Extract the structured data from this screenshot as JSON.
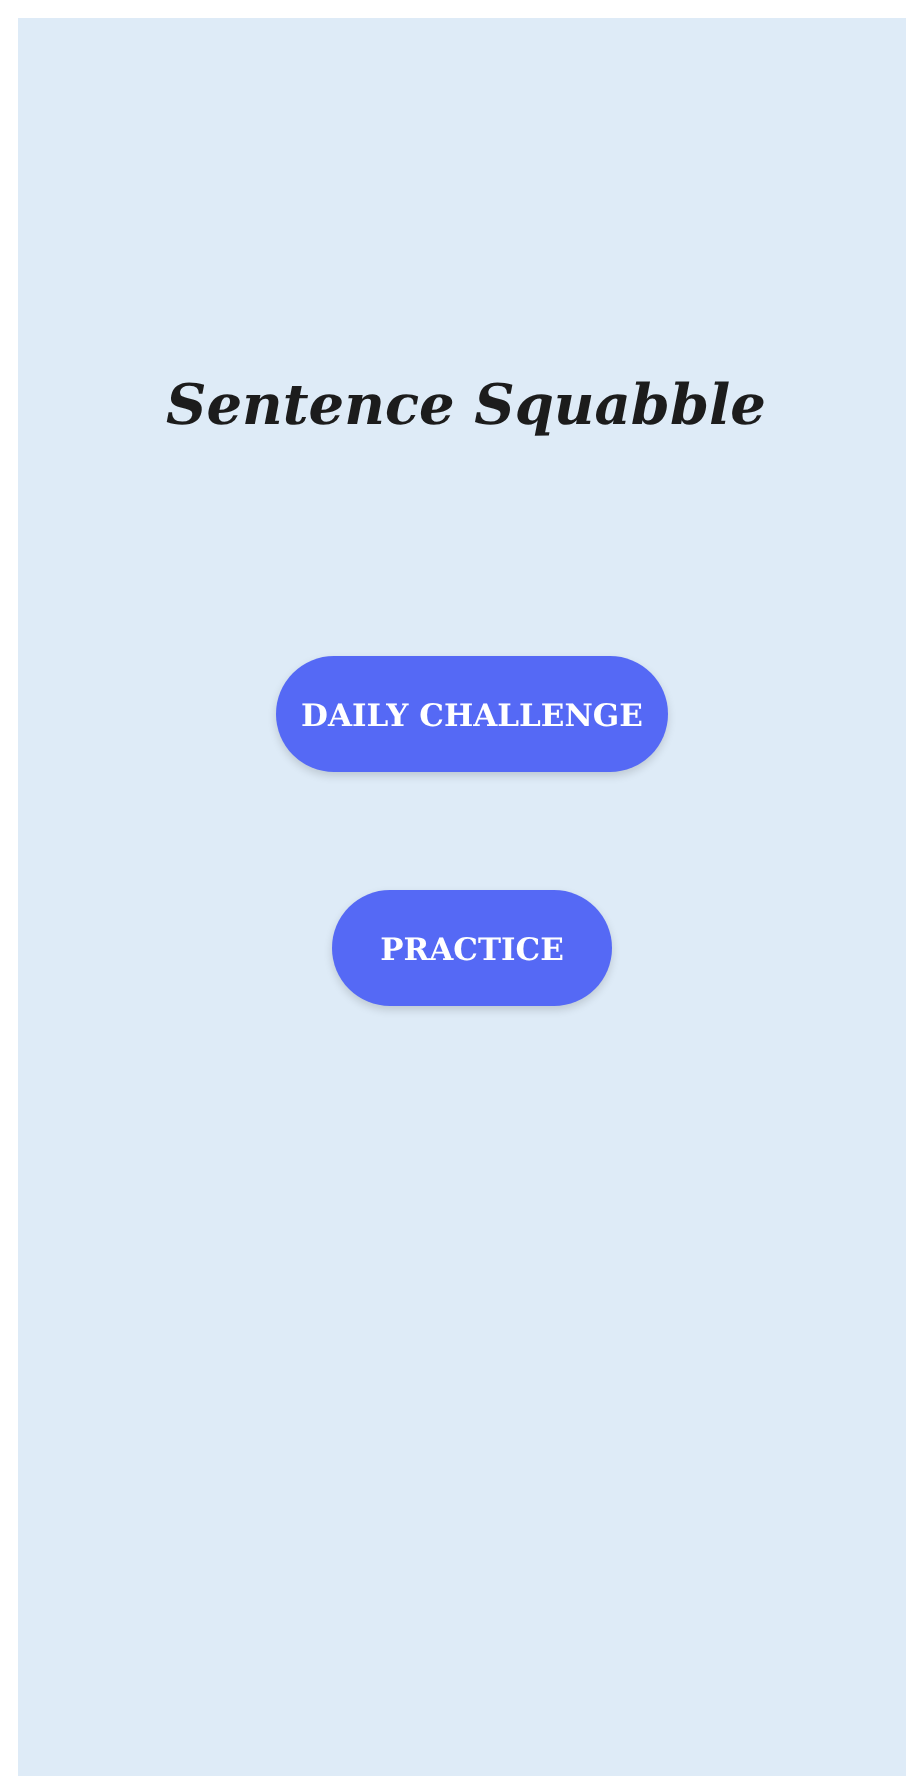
{
  "title": "Sentence Squabble",
  "buttons": [
    "DAILY CHALLENGE",
    "PRACTICE"
  ]
}
